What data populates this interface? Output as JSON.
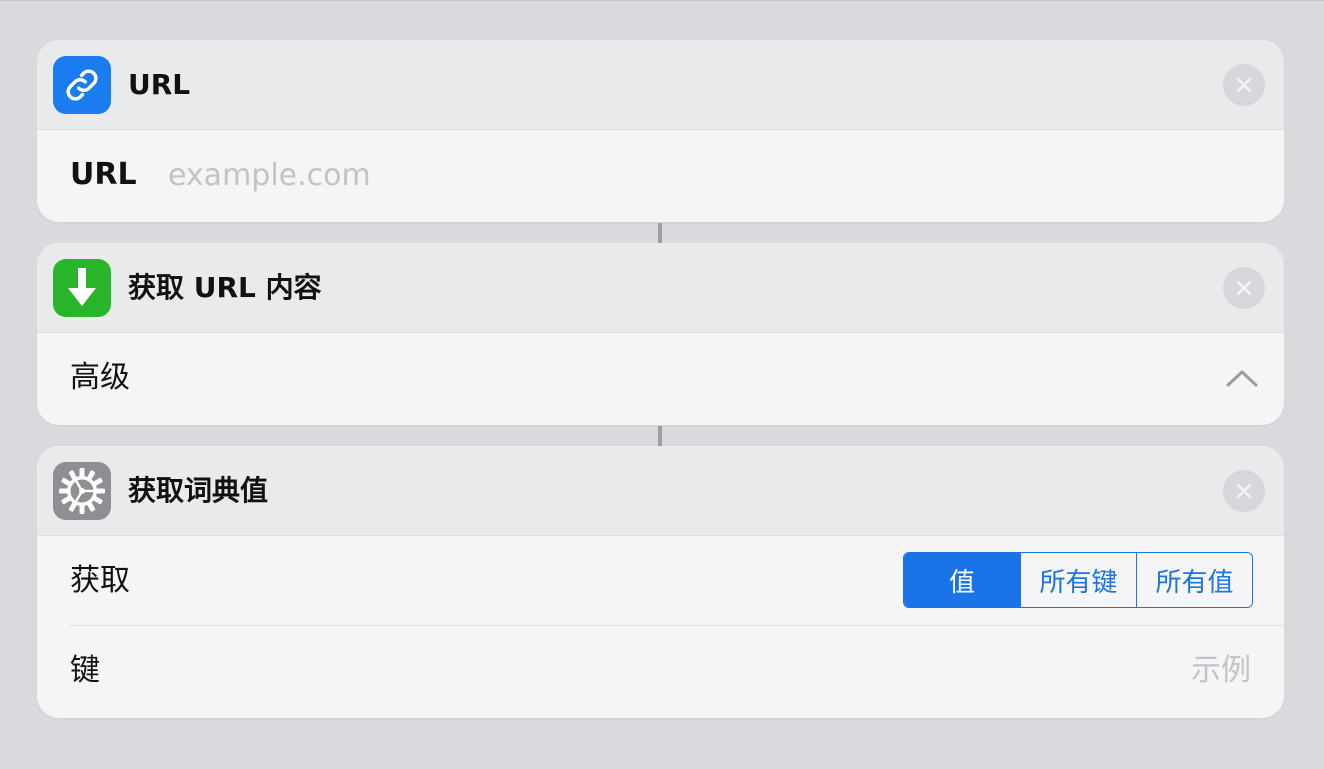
{
  "actions": [
    {
      "title": "URL",
      "icon": "link-icon",
      "icon_color": "#1a7cf0",
      "field_label": "URL",
      "field_placeholder": "example.com",
      "field_value": ""
    },
    {
      "title": "获取 URL 内容",
      "icon": "download-arrow-icon",
      "icon_color": "#29b52a",
      "row_label": "高级",
      "expanded": true
    },
    {
      "title": "获取词典值",
      "icon": "gear-icon",
      "icon_color": "#8e8e93",
      "get_label": "获取",
      "get_options": [
        "值",
        "所有键",
        "所有值"
      ],
      "get_selected": "值",
      "key_label": "键",
      "key_placeholder": "示例"
    }
  ],
  "colors": {
    "accent": "#1a74e8",
    "background": "#d9dadd",
    "card": "#f5f5f6",
    "card_header": "#e9eaec",
    "placeholder": "#c2c3c7"
  }
}
